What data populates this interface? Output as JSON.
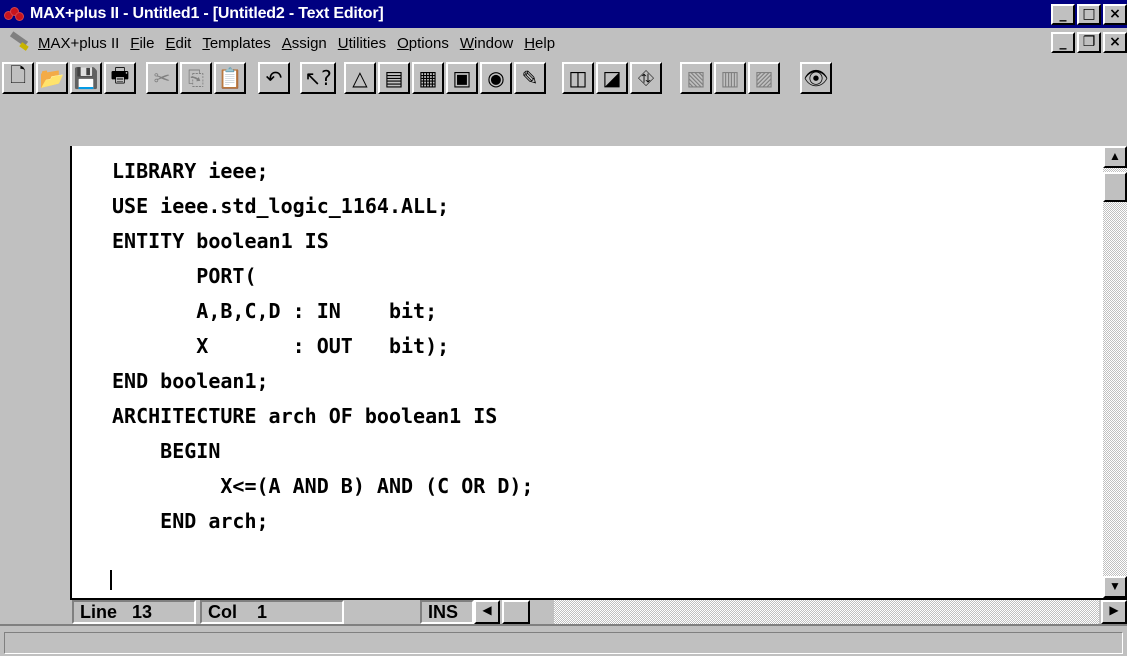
{
  "window": {
    "title": "MAX+plus II - Untitled1 - [Untitled2 - Text Editor]",
    "minimize": "_",
    "maximize": "□",
    "close": "×"
  },
  "menu": {
    "items": [
      {
        "label": "MAX+plus II",
        "ul": "M"
      },
      {
        "label": "File",
        "ul": "F"
      },
      {
        "label": "Edit",
        "ul": "E"
      },
      {
        "label": "Templates",
        "ul": "T"
      },
      {
        "label": "Assign",
        "ul": "A"
      },
      {
        "label": "Utilities",
        "ul": "U"
      },
      {
        "label": "Options",
        "ul": "O"
      },
      {
        "label": "Window",
        "ul": "W"
      },
      {
        "label": "Help",
        "ul": "H"
      }
    ],
    "mdi_minimize": "_",
    "mdi_restore": "❐",
    "mdi_close": "×"
  },
  "toolbar": {
    "buttons": [
      {
        "name": "new-file",
        "glyph": "🗋",
        "disabled": false
      },
      {
        "name": "open-file",
        "glyph": "📂",
        "disabled": false
      },
      {
        "name": "save-file",
        "glyph": "💾",
        "disabled": false
      },
      {
        "name": "print",
        "glyph": "🖶",
        "disabled": false
      },
      {
        "name": "cut",
        "glyph": "✂",
        "disabled": true
      },
      {
        "name": "copy",
        "glyph": "⎘",
        "disabled": true
      },
      {
        "name": "paste",
        "glyph": "📋",
        "disabled": false
      },
      {
        "name": "undo",
        "glyph": "↶",
        "disabled": false
      },
      {
        "name": "context-help",
        "glyph": "↖?",
        "disabled": false
      },
      {
        "name": "hierarchy-up",
        "glyph": "△",
        "disabled": false
      },
      {
        "name": "open-hierarchy",
        "glyph": "▤",
        "disabled": false
      },
      {
        "name": "floorplan",
        "glyph": "▦",
        "disabled": false
      },
      {
        "name": "compiler",
        "glyph": "▣",
        "disabled": false
      },
      {
        "name": "simulator",
        "glyph": "◉",
        "disabled": false
      },
      {
        "name": "timing",
        "glyph": "✎",
        "disabled": false
      },
      {
        "name": "programmer",
        "glyph": "◫",
        "disabled": false
      },
      {
        "name": "project-save",
        "glyph": "◪",
        "disabled": false
      },
      {
        "name": "project-compile",
        "glyph": "⛗",
        "disabled": false
      },
      {
        "name": "toggle-a",
        "glyph": "▧",
        "disabled": true
      },
      {
        "name": "toggle-b",
        "glyph": "▥",
        "disabled": true
      },
      {
        "name": "toggle-c",
        "glyph": "▨",
        "disabled": true
      },
      {
        "name": "find-text",
        "glyph": "👁",
        "disabled": false
      }
    ]
  },
  "editor": {
    "lines": [
      "LIBRARY ieee;",
      "USE ieee.std_logic_1164.ALL;",
      "ENTITY boolean1 IS",
      "       PORT(",
      "       A,B,C,D : IN    bit;",
      "       X       : OUT   bit);",
      "END boolean1;",
      "ARCHITECTURE arch OF boolean1 IS",
      "    BEGIN",
      "         X<=(A AND B) AND (C OR D);",
      "    END arch;",
      "",
      ""
    ]
  },
  "status": {
    "line_label": "Line   13",
    "col_label": "Col    1",
    "mode": "INS"
  }
}
